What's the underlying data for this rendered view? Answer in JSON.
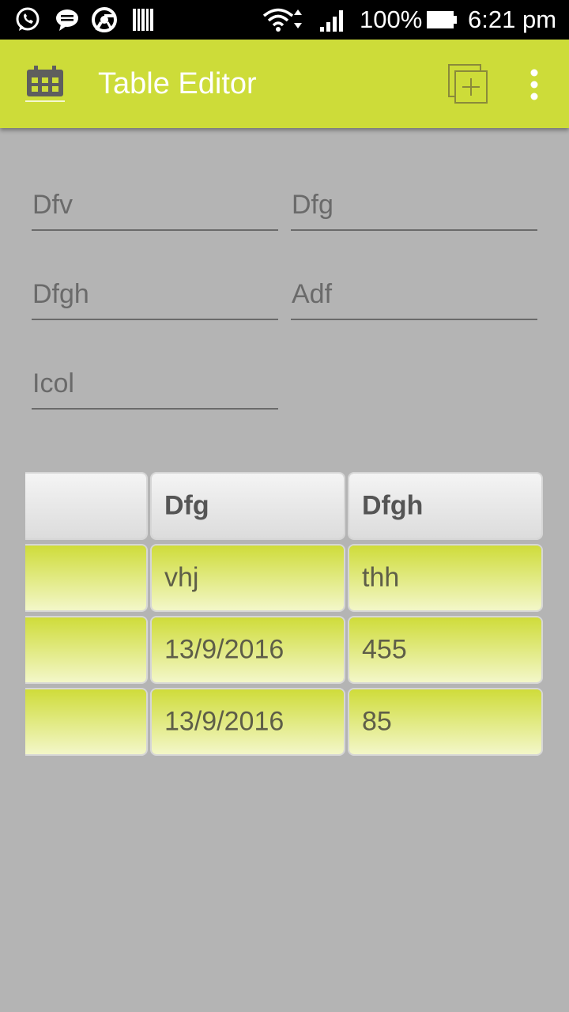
{
  "status_bar": {
    "battery": "100%",
    "time": "6:21 pm",
    "notification_icons": [
      "whatsapp-icon",
      "message-icon",
      "chrome-icon",
      "barcode-icon"
    ],
    "system_icons": [
      "wifi-icon",
      "signal-icon",
      "battery-icon"
    ]
  },
  "app_bar": {
    "title": "Table Editor",
    "icon": "calendar-icon",
    "actions": [
      "add-table-icon",
      "overflow-menu-icon"
    ],
    "color": "#cddc39"
  },
  "fields": [
    {
      "placeholder": "Dfv",
      "value": ""
    },
    {
      "placeholder": "Dfg",
      "value": ""
    },
    {
      "placeholder": "Dfgh",
      "value": ""
    },
    {
      "placeholder": "Adf",
      "value": ""
    },
    {
      "placeholder": "Icol",
      "value": ""
    }
  ],
  "table": {
    "headers": [
      "",
      "Dfg",
      "Dfgh"
    ],
    "rows": [
      [
        "",
        "vhj",
        "thh"
      ],
      [
        "",
        "13/9/2016",
        "455"
      ],
      [
        "",
        "13/9/2016",
        "85"
      ]
    ]
  }
}
